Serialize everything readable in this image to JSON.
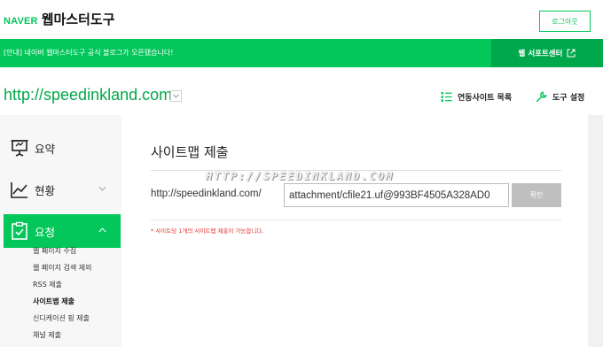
{
  "header": {
    "brand_naver": "NAVER",
    "brand_service": "웹마스터도구",
    "logout_label": "로그아웃"
  },
  "notice": {
    "text": "[안내] 네이버 웹마스터도구 공식 블로그가 오픈됐습니다!",
    "support_label": "웹 서포트센터"
  },
  "site": {
    "url": "http://speedinkland.com",
    "linked_sites_label": "연동사이트 목록",
    "tool_settings_label": "도구 설정"
  },
  "sidebar": {
    "items": [
      {
        "label": "요약",
        "icon": "presentation-icon"
      },
      {
        "label": "현황",
        "icon": "chart-icon"
      },
      {
        "label": "요청",
        "icon": "clipboard-check-icon"
      }
    ],
    "sub_items": [
      {
        "label": "웹 페이지 수집"
      },
      {
        "label": "웹 페이지 검색 제외"
      },
      {
        "label": "RSS 제출"
      },
      {
        "label": "사이트맵 제출"
      },
      {
        "label": "신디케이션 핑 제출"
      },
      {
        "label": "채널 제출"
      }
    ]
  },
  "main": {
    "title": "사이트맵 제출",
    "prefix": "http://speedinkland.com/",
    "input_value": "attachment/cfile21.uf@993BF4505A328AD0",
    "confirm_label": "확인",
    "note": "* 사이트당 1개의 사이트맵 제출이 가능합니다."
  },
  "watermark": "HTTP://SPEEDINKLAND.COM",
  "colors": {
    "accent": "#03c75a",
    "support_bg": "#00a84c",
    "error": "#e03131"
  }
}
